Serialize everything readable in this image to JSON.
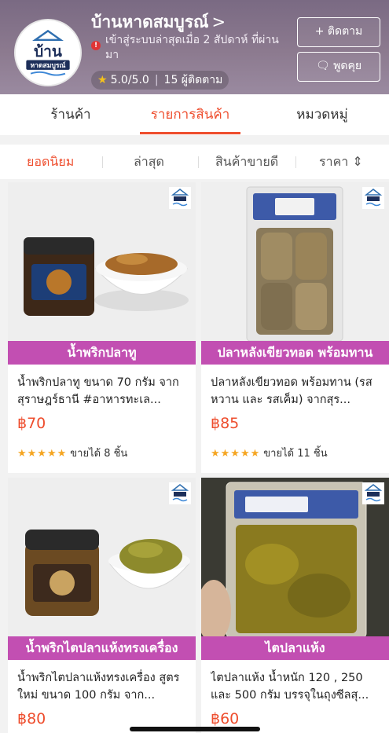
{
  "shop": {
    "name": "บ้านหาดสมบูรณ์",
    "name_chevron": ">",
    "status": "เข้าสู่ระบบล่าสุดเมื่อ 2 สัปดาห์ ที่ผ่านมา",
    "status_icon": "!",
    "rating": "5.0/5.0",
    "followers": "15 ผู้ติดตาม",
    "follow_label": "+ ติดตาม",
    "chat_label": "พูดคุย",
    "logo_text_top": "บ้าน",
    "logo_text_bottom": "หาดสมบูรณ์"
  },
  "tabs": [
    {
      "label": "ร้านค้า",
      "active": false
    },
    {
      "label": "รายการสินค้า",
      "active": true
    },
    {
      "label": "หมวดหมู่",
      "active": false
    }
  ],
  "sort": [
    {
      "label": "ยอดนิยม",
      "active": true
    },
    {
      "label": "ล่าสุด",
      "active": false
    },
    {
      "label": "สินค้าขายดี",
      "active": false
    },
    {
      "label": "ราคา",
      "active": false
    }
  ],
  "products": [
    {
      "banner": "น้ำพริกปลาทู",
      "title": "น้ำพริกปลาทู ขนาด 70 กรัม จากสุราษฎร์ธานี #อาหารทะเล...",
      "price": "฿70",
      "stars": "★★★★★",
      "sold": "ขายได้ 8 ชิ้น"
    },
    {
      "banner": "ปลาหลังเขียวทอด พร้อมทาน",
      "title": "ปลาหลังเขียวทอด พร้อมทาน (รสหวาน และ รสเค็ม) จากสุร...",
      "price": "฿85",
      "stars": "★★★★★",
      "sold": "ขายได้ 11 ชิ้น"
    },
    {
      "banner": "น้ำพริกไตปลาแห้งทรงเครื่อง",
      "title": "น้ำพริกไตปลาแห้งทรงเครื่อง สูตรใหม่ ขนาด 100 กรัม จาก...",
      "price": "฿80"
    },
    {
      "banner": "ไตปลาแห้ง",
      "title": "ไตปลาแห้ง น้ำหนัก 120 , 250 และ 500 กรัม บรรจุในถุงซีลสุ...",
      "price": "฿60"
    }
  ],
  "colors": {
    "accent": "#ee4d2d",
    "banner": "#c24fb2",
    "header": "#8c7a8f"
  }
}
